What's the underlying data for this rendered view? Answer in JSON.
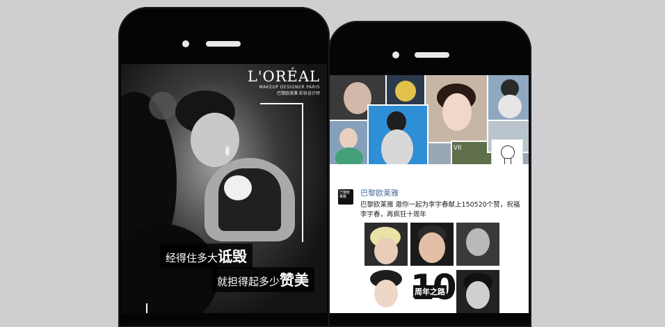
{
  "left_phone": {
    "brand": {
      "name": "L'ORÉAL",
      "sub": "MAKEUP DESIGNER PARIS",
      "sub_cn": "巴黎欧莱雅 彩妆设计师"
    },
    "slogan_line1_light": "经得住多大",
    "slogan_line1_bold": "诋毁",
    "slogan_line2_light": "就担得起多少",
    "slogan_line2_bold": "赞美"
  },
  "right_phone": {
    "collage_label": "VII",
    "poster_name": "巴黎欧莱雅",
    "post_text": "巴黎欧莱雅 邀你一起为李宇春献上150520个赞，祝福李宇春，再疯狂十周年",
    "logo_text": "巴黎欧莱雅",
    "anniv_number": "10",
    "anniv_label": "周年之路"
  },
  "colors": {
    "background": "#cfcfd1",
    "phone_body": "#050505",
    "link_blue": "#4a6a9a"
  }
}
